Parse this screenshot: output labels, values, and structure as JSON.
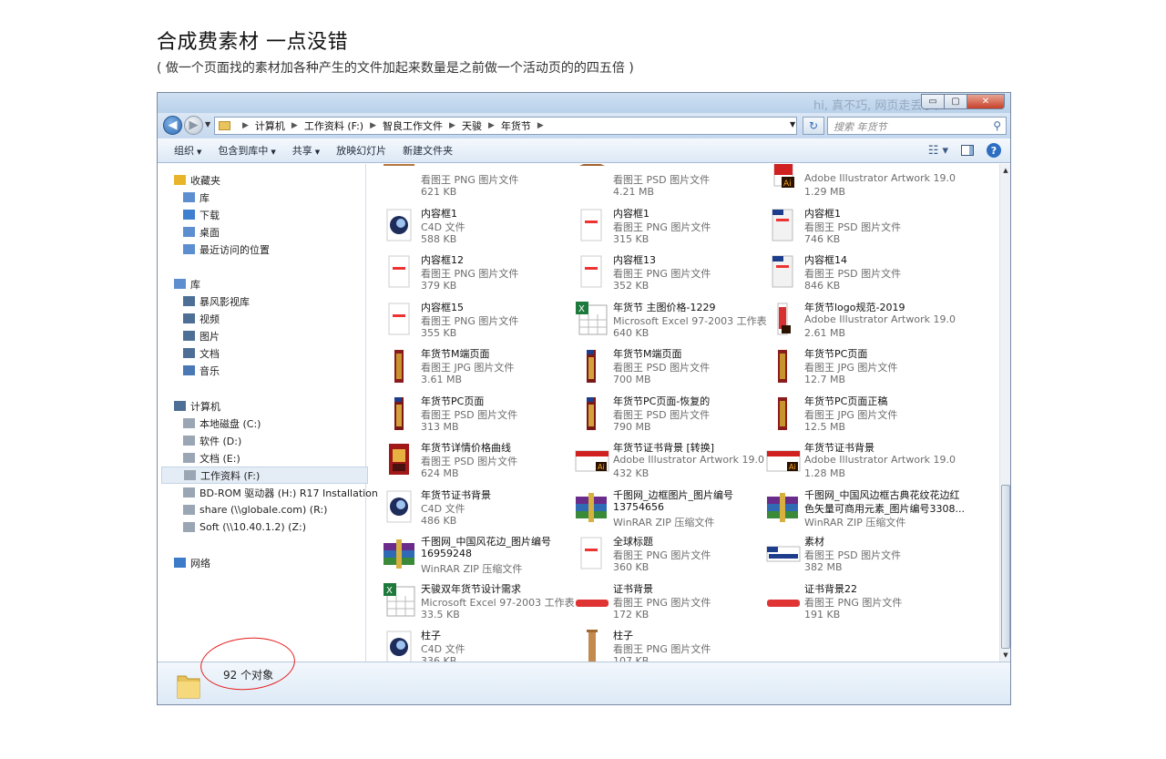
{
  "page": {
    "title": "合成费素材  一点没错",
    "subtitle": "( 做一个页面找的素材加各种产生的文件加起来数量是之前做一个活动页的的四五倍 )"
  },
  "window": {
    "ghost_text": "hi, 真不巧, 网页走丢了。",
    "min_label": "▭",
    "max_label": "▢",
    "close_label": "✕"
  },
  "address": {
    "crumbs": [
      "计算机",
      "工作资料 (F:)",
      "智良工作文件",
      "天骏",
      "年货节"
    ],
    "search_placeholder": "搜索 年货节"
  },
  "toolbar": {
    "items": [
      "组织",
      "包含到库中",
      "共享",
      "放映幻灯片",
      "新建文件夹"
    ]
  },
  "sidebar": {
    "favorites": {
      "label": "收藏夹",
      "items": [
        "库",
        "下载",
        "桌面",
        "最近访问的位置"
      ]
    },
    "libraries": {
      "label": "库",
      "items": [
        "暴风影视库",
        "视频",
        "图片",
        "文档",
        "音乐"
      ]
    },
    "computer": {
      "label": "计算机",
      "items": [
        "本地磁盘 (C:)",
        "软件 (D:)",
        "文档 (E:)",
        "工作资料 (F:)",
        "BD-ROM 驱动器 (H:) R17 Installation",
        "share (\\\\globale.com) (R:)",
        "Soft (\\\\10.40.1.2) (Z:)"
      ]
    },
    "network": {
      "label": "网络"
    }
  },
  "files": [
    {
      "name": "",
      "type": "看图王 PNG 图片文件",
      "size": "621 KB",
      "icon": "png-bar"
    },
    {
      "name": "",
      "type": "看图王 PSD 图片文件",
      "size": "4.21 MB",
      "icon": "psd-bar"
    },
    {
      "name": "",
      "type": "Adobe Illustrator Artwork 19.0",
      "size": "1.29 MB",
      "icon": "ai"
    },
    {
      "name": "内容框1",
      "type": "C4D 文件",
      "size": "588 KB",
      "icon": "c4d"
    },
    {
      "name": "内容框1",
      "type": "看图王 PNG 图片文件",
      "size": "315 KB",
      "icon": "png-page"
    },
    {
      "name": "内容框1",
      "type": "看图王 PSD 图片文件",
      "size": "746 KB",
      "icon": "psd-page"
    },
    {
      "name": "内容框12",
      "type": "看图王 PNG 图片文件",
      "size": "379 KB",
      "icon": "png-page"
    },
    {
      "name": "内容框13",
      "type": "看图王 PNG 图片文件",
      "size": "352 KB",
      "icon": "png-page"
    },
    {
      "name": "内容框14",
      "type": "看图王 PSD 图片文件",
      "size": "846 KB",
      "icon": "psd-page"
    },
    {
      "name": "内容框15",
      "type": "看图王 PNG 图片文件",
      "size": "355 KB",
      "icon": "png-page"
    },
    {
      "name": "年货节 主图价格-1229",
      "type": "Microsoft Excel 97-2003 工作表",
      "size": "640 KB",
      "icon": "excel"
    },
    {
      "name": "年货节logo规范-2019",
      "type": "Adobe Illustrator Artwork 19.0",
      "size": "2.61 MB",
      "icon": "ai-tall"
    },
    {
      "name": "年货节M端页面",
      "type": "看图王 JPG 图片文件",
      "size": "3.61 MB",
      "icon": "jpg-tall"
    },
    {
      "name": "年货节M端页面",
      "type": "看图王 PSD 图片文件",
      "size": "700 MB",
      "icon": "psd-tall"
    },
    {
      "name": "年货节PC页面",
      "type": "看图王 JPG 图片文件",
      "size": "12.7 MB",
      "icon": "jpg-tall"
    },
    {
      "name": "年货节PC页面",
      "type": "看图王 PSD 图片文件",
      "size": "313 MB",
      "icon": "psd-tall"
    },
    {
      "name": "年货节PC页面-恢复的",
      "type": "看图王 PSD 图片文件",
      "size": "790 MB",
      "icon": "psd-tall"
    },
    {
      "name": "年货节PC页面正稿",
      "type": "看图王 JPG 图片文件",
      "size": "12.5 MB",
      "icon": "jpg-tall"
    },
    {
      "name": "年货节详情价格曲线",
      "type": "看图王 PSD 图片文件",
      "size": "624 MB",
      "icon": "psd-box"
    },
    {
      "name": "年货节证书背景 [转换]",
      "type": "Adobe Illustrator Artwork 19.0",
      "size": "432 KB",
      "icon": "ai-wide"
    },
    {
      "name": "年货节证书背景",
      "type": "Adobe Illustrator Artwork 19.0",
      "size": "1.28 MB",
      "icon": "ai-wide"
    },
    {
      "name": "年货节证书背景",
      "type": "C4D 文件",
      "size": "486 KB",
      "icon": "c4d"
    },
    {
      "name": "千图网_边框图片_图片编号",
      "name2": "13754656",
      "type": "WinRAR ZIP 压缩文件",
      "size": "",
      "icon": "rar"
    },
    {
      "name": "千图网_中国风边框古典花纹花边红",
      "name2": "色矢量可商用元素_图片编号3308...",
      "type": "WinRAR ZIP 压缩文件",
      "size": "",
      "icon": "rar"
    },
    {
      "name": "千图网_中国风花边_图片编号",
      "name2": "16959248",
      "type": "WinRAR ZIP 压缩文件",
      "size": "",
      "icon": "rar"
    },
    {
      "name": "全球标题",
      "type": "看图王 PNG 图片文件",
      "size": "360 KB",
      "icon": "png-page"
    },
    {
      "name": "素材",
      "type": "看图王 PSD 图片文件",
      "size": "382 MB",
      "icon": "psd-wide"
    },
    {
      "name": "天骏双年货节设计需求",
      "type": "Microsoft Excel 97-2003 工作表",
      "size": "33.5 KB",
      "icon": "excel"
    },
    {
      "name": "证书背景",
      "type": "看图王 PNG 图片文件",
      "size": "172 KB",
      "icon": "png-red"
    },
    {
      "name": "证书背景22",
      "type": "看图王 PNG 图片文件",
      "size": "191 KB",
      "icon": "png-red"
    },
    {
      "name": "柱子",
      "type": "C4D 文件",
      "size": "336 KB",
      "icon": "c4d"
    },
    {
      "name": "柱子",
      "type": "看图王 PNG 图片文件",
      "size": "107 KB",
      "icon": "png-pillar"
    }
  ],
  "status": {
    "count_text": "92 个对象"
  },
  "colors": {
    "accent": "#2e6db5",
    "annotation": "#e41c1c"
  }
}
